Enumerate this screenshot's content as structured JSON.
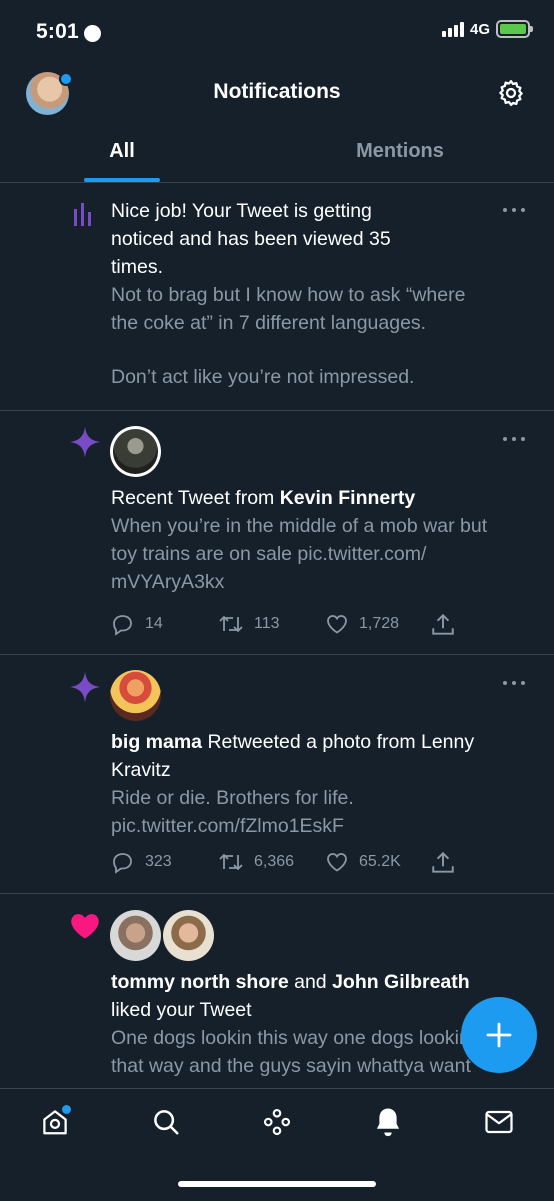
{
  "status_bar": {
    "time": "5:01",
    "network": "4G"
  },
  "header": {
    "title": "Notifications"
  },
  "tabs": [
    {
      "label": "All"
    },
    {
      "label": "Mentions"
    }
  ],
  "notifications": [
    {
      "title_line1": "Nice job! Your Tweet is getting",
      "title_line2": "noticed and has been viewed 35",
      "title_line3": "times.",
      "tweet_line1": "Not to brag but I know how to ask “where",
      "tweet_line2": "the coke at” in 7 different languages.",
      "tweet_line3": "Don’t act like you’re not impressed."
    },
    {
      "prefix": "Recent Tweet from ",
      "author": "Kevin Finnerty",
      "tweet_line1": "When you’re in the middle of a mob war but",
      "tweet_line2": "toy trains are on sale pic.twitter.com/",
      "tweet_line3": "mVYAryA3kx",
      "replies": "14",
      "retweets": "113",
      "likes": "1,728"
    },
    {
      "author": "big mama",
      "action_line1": " Retweeted a photo from Lenny",
      "action_line2": "Kravitz",
      "tweet_line1": "Ride or die. Brothers for life.",
      "tweet_line2": "pic.twitter.com/fZlmo1EskF",
      "replies": "323",
      "retweets": "6,366",
      "likes": "65.2K"
    },
    {
      "author1": "tommy north shore",
      "connector": " and ",
      "author2": "John Gilbreath",
      "action": "liked your Tweet",
      "tweet_line1": "One dogs lookin this way one dogs lookin",
      "tweet_line2": "that way and the guys sayin whattya want"
    }
  ],
  "colors": {
    "background": "#15202b",
    "accent": "#1d9bf0",
    "muted": "#8b98a5",
    "purple": "#794bc4",
    "like_pink": "#f91880"
  },
  "icons": {
    "views": "bar-chart-icon",
    "spark": "sparkle-icon",
    "like": "heart-icon",
    "reply": "reply-icon",
    "retweet": "retweet-icon",
    "share": "share-icon",
    "compose": "plus-icon"
  }
}
